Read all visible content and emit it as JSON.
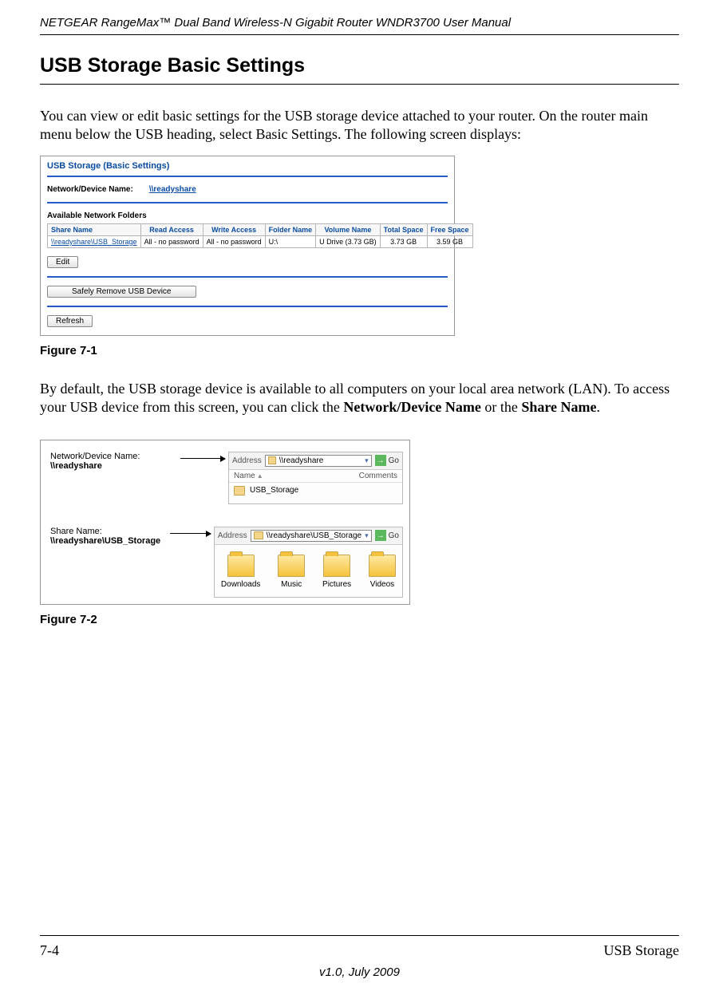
{
  "header": {
    "title": "NETGEAR RangeMax™ Dual Band Wireless-N Gigabit Router WNDR3700 User Manual"
  },
  "section_title": "USB Storage Basic Settings",
  "para1": "You can view or edit basic settings for the USB storage device attached to your router. On the router main menu below the USB heading, select Basic Settings. The following screen displays:",
  "fig1": {
    "title": "USB Storage (Basic Settings)",
    "netdev_label": "Network/Device Name:",
    "netdev_link": "\\\\readyshare",
    "avfold_label": "Available Network Folders",
    "columns": [
      "Share Name",
      "Read Access",
      "Write Access",
      "Folder Name",
      "Volume Name",
      "Total Space",
      "Free Space"
    ],
    "row": [
      "\\\\readyshare\\USB_Storage",
      "All - no password",
      "All - no password",
      "U:\\",
      "U Drive (3.73 GB)",
      "3.73 GB",
      "3.59 GB"
    ],
    "edit": "Edit",
    "safely": "Safely Remove USB Device",
    "refresh": "Refresh",
    "caption": "Figure 7-1"
  },
  "para2_a": "By default, the USB storage device is available to all computers on your local area network (LAN). To access your USB device from this screen, you can click the ",
  "para2_b": "Network/Device Name",
  "para2_c": " or the ",
  "para2_d": "Share Name",
  "para2_e": ".",
  "fig2": {
    "label1a": "Network/Device Name:",
    "label1b": "\\\\readyshare",
    "addr_label": "Address",
    "addr1": "\\\\readyshare",
    "go": "Go",
    "col_name": "Name",
    "col_comments": "Comments",
    "item1": "USB_Storage",
    "label2a": "Share Name:",
    "label2b": "\\\\readyshare\\USB_Storage",
    "addr2": "\\\\readyshare\\USB_Storage",
    "folders": [
      "Downloads",
      "Music",
      "Pictures",
      "Videos"
    ],
    "caption": "Figure 7-2"
  },
  "footer": {
    "left": "7-4",
    "right": "USB Storage",
    "version": "v1.0, July 2009"
  }
}
